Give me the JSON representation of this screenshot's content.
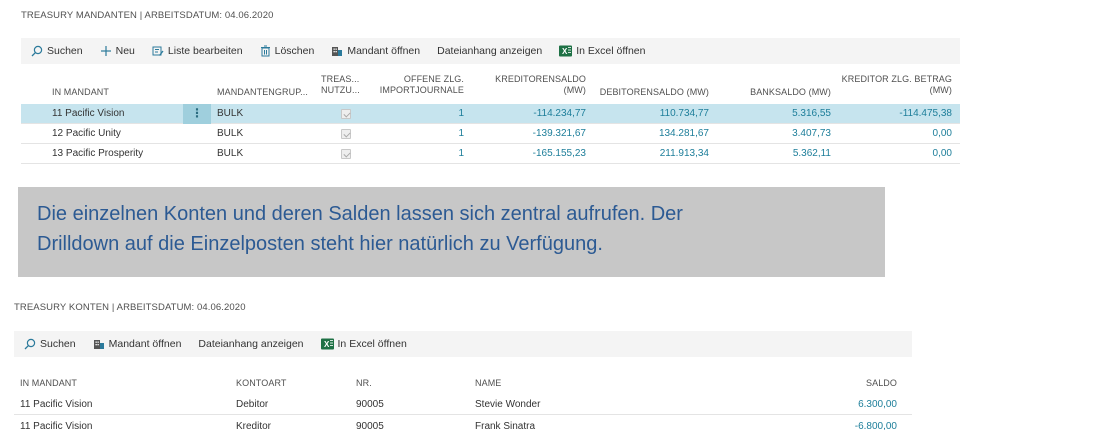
{
  "top": {
    "title": "TREASURY MANDANTEN | ARBEITSDATUM: 04.06.2020",
    "toolbar": {
      "search": "Suchen",
      "new": "Neu",
      "edit_list": "Liste bearbeiten",
      "delete": "Löschen",
      "open_client": "Mandant öffnen",
      "show_attachment": "Dateianhang anzeigen",
      "open_excel": "In Excel öffnen"
    },
    "headers": {
      "mandant": "IN MANDANT",
      "group": "MANDANTENGRUP...",
      "treas_1": "TREAS...",
      "treas_2": "NUTZU...",
      "open_1": "OFFENE ZLG.",
      "open_2": "IMPORTJOURNALE",
      "cred_1": "KREDITORENSALDO",
      "cred_2": "(MW)",
      "deb": "DEBITORENSALDO (MW)",
      "bank": "BANKSALDO (MW)",
      "crpay_1": "KREDITOR ZLG. BETRAG",
      "crpay_2": "(MW)"
    },
    "rows": [
      {
        "mandant": "11 Pacific Vision",
        "group": "BULK",
        "open": "1",
        "cred": "-114.234,77",
        "deb": "110.734,77",
        "bank": "5.316,55",
        "crpay": "-114.475,38"
      },
      {
        "mandant": "12 Pacific Unity",
        "group": "BULK",
        "open": "1",
        "cred": "-139.321,67",
        "deb": "134.281,67",
        "bank": "3.407,73",
        "crpay": "0,00"
      },
      {
        "mandant": "13 Pacific Prosperity",
        "group": "BULK",
        "open": "1",
        "cred": "-165.155,23",
        "deb": "211.913,34",
        "bank": "5.362,11",
        "crpay": "0,00"
      }
    ]
  },
  "callout": {
    "line1": "Die einzelnen Konten und deren Salden lassen sich zentral aufrufen. Der",
    "line2": "Drilldown auf die Einzelposten steht hier natürlich zu Verfügung."
  },
  "bottom": {
    "title": "TREASURY KONTEN | ARBEITSDATUM: 04.06.2020",
    "toolbar": {
      "search": "Suchen",
      "open_client": "Mandant öffnen",
      "show_attachment": "Dateianhang anzeigen",
      "open_excel": "In Excel öffnen"
    },
    "headers": {
      "mandant": "IN MANDANT",
      "account_type": "KONTOART",
      "no": "NR.",
      "name": "NAME",
      "balance": "SALDO"
    },
    "rows": [
      {
        "mandant": "11 Pacific Vision",
        "account_type": "Debitor",
        "no": "90005",
        "name": "Stevie Wonder",
        "balance": "6.300,00"
      },
      {
        "mandant": "11 Pacific Vision",
        "account_type": "Kreditor",
        "no": "90005",
        "name": "Frank Sinatra",
        "balance": "-6.800,00"
      }
    ]
  }
}
